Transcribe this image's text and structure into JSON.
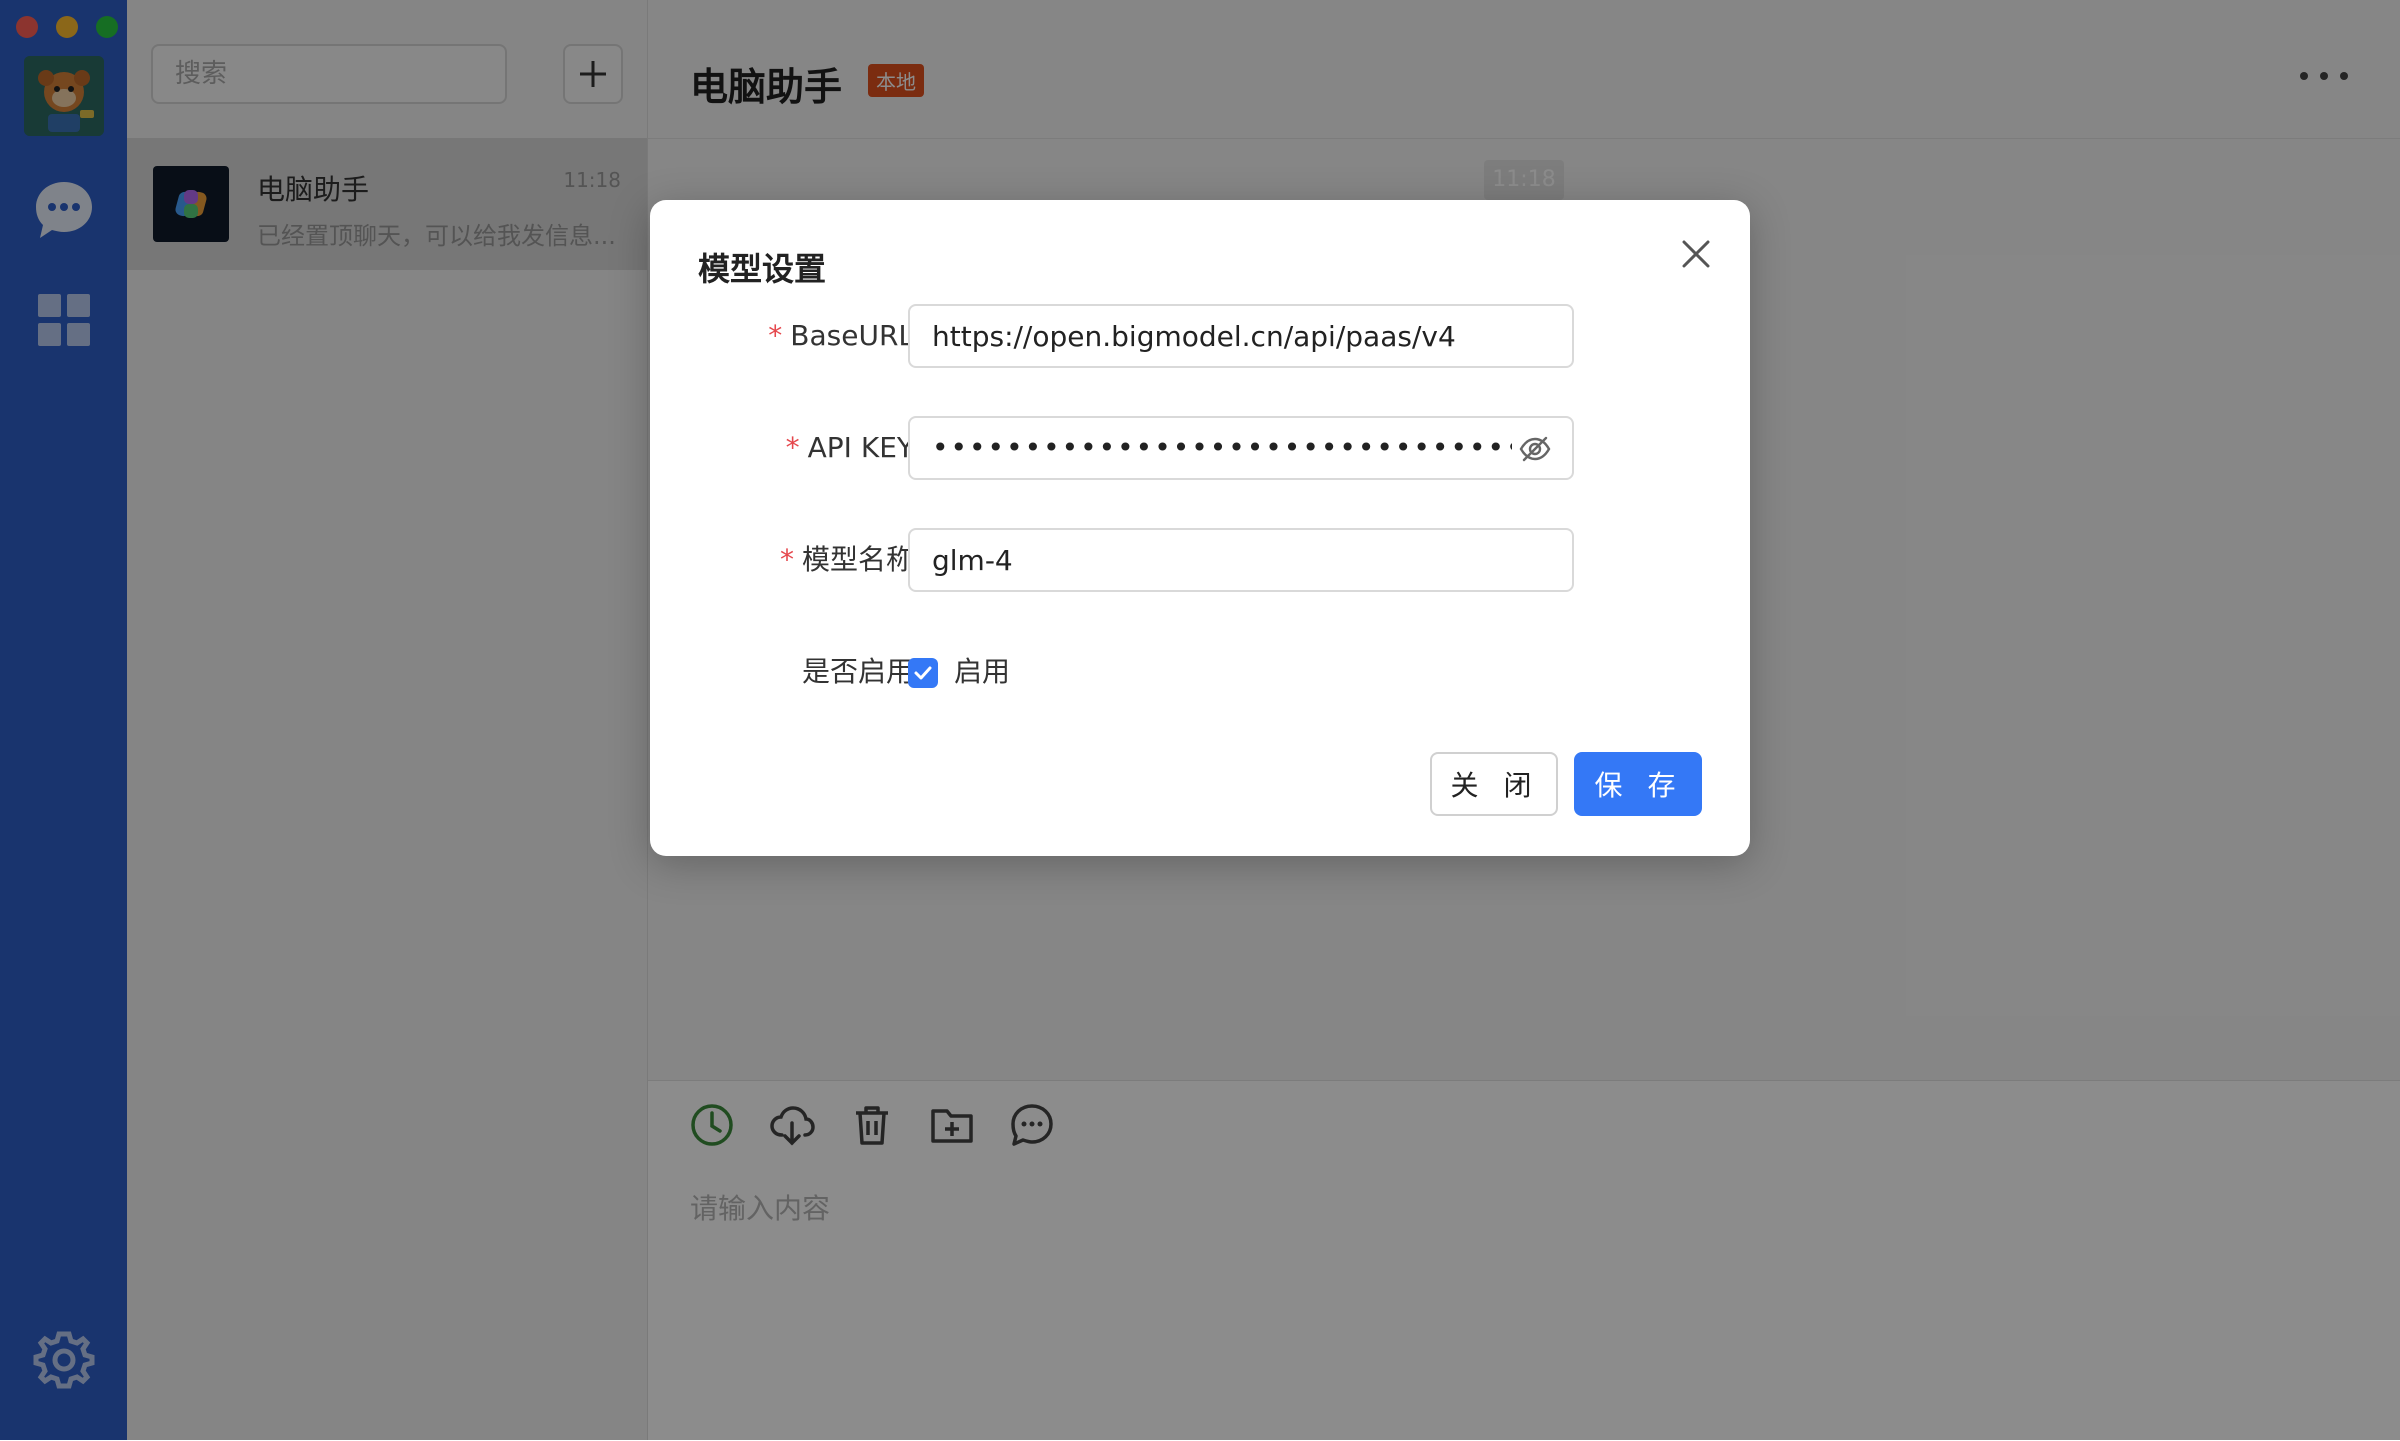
{
  "sidebar": {
    "icons": [
      "avatar",
      "chat-bubble-icon",
      "apps-grid-icon",
      "gear-icon"
    ]
  },
  "conversation_list": {
    "search_placeholder": "搜索",
    "add_label": "+",
    "items": [
      {
        "name": "电脑助手",
        "time": "11:18",
        "preview": "已经置顶聊天，可以给我发信息..."
      }
    ]
  },
  "chat": {
    "title": "电脑助手",
    "badge": "本地",
    "message_time": "11:18",
    "input_placeholder": "请输入内容",
    "toolbar_icons": [
      "history-clock-icon",
      "cloud-download-icon",
      "trash-icon",
      "folder-add-icon",
      "chat-more-icon"
    ]
  },
  "modal": {
    "title": "模型设置",
    "fields": {
      "base_url": {
        "label": "BaseURL：",
        "value": "https://open.bigmodel.cn/api/paas/v4"
      },
      "api_key": {
        "label": "API KEY：",
        "masked": "••••••••••••••••••••••••••••••••••••••••••••••"
      },
      "model_name": {
        "label": "模型名称：",
        "value": "glm-4"
      },
      "enabled": {
        "label": "是否启用：",
        "checkbox_label": "启用",
        "checked": true
      }
    },
    "required_mark": "*",
    "buttons": {
      "close": "关 闭",
      "save": "保 存"
    }
  },
  "colors": {
    "rail": "#2e5fc9",
    "accent": "#3478f6",
    "badge": "#e0501e",
    "required": "#e5484d"
  }
}
